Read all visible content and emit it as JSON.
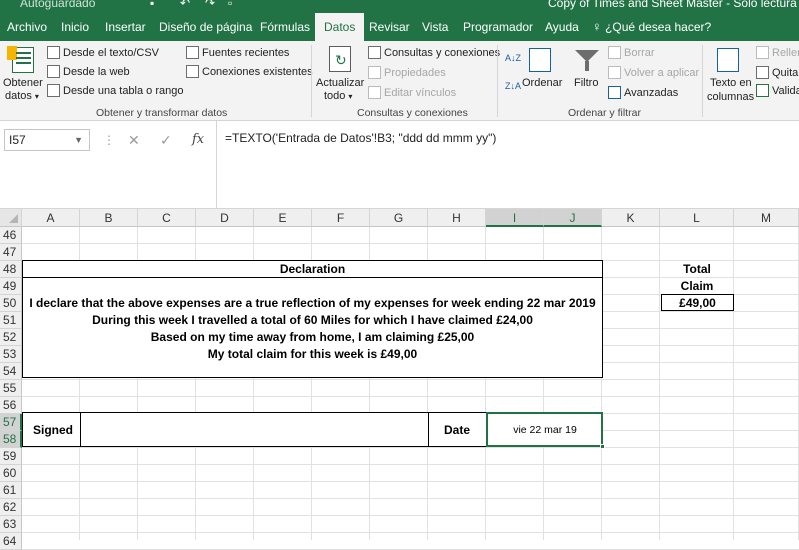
{
  "titlebar": {
    "autosave_label": "Autoguardado",
    "doc_title": "Copy of Times and Sheet Master - Solo lectura",
    "qa_save_icon": "save-icon",
    "qa_undo_icon": "undo-icon",
    "qa_redo_icon": "redo-icon",
    "qa_preview_icon": "print-preview-icon"
  },
  "tabs": [
    "Archivo",
    "Inicio",
    "Insertar",
    "Diseño de página",
    "Fórmulas",
    "Datos",
    "Revisar",
    "Vista",
    "Programador",
    "Ayuda"
  ],
  "active_tab": "Datos",
  "tell_me": "¿Qué desea hacer?",
  "ribbon": {
    "get_data": {
      "line1": "Obtener",
      "line2": "datos",
      "dropdown": "▾"
    },
    "from_text": "Desde el texto/CSV",
    "from_web": "Desde la web",
    "from_table": "Desde una tabla o rango",
    "recent_sources": "Fuentes recientes",
    "existing_connections": "Conexiones existentes",
    "group_get": "Obtener y transformar datos",
    "refresh": {
      "line1": "Actualizar",
      "line2": "todo",
      "dropdown": "▾"
    },
    "queries": "Consultas y conexiones",
    "properties": "Propiedades",
    "edit_links": "Editar vínculos",
    "group_queries": "Consultas y conexiones",
    "sort_az": "A↓Z",
    "sort_za": "Z↓A",
    "sort": "Ordenar",
    "filter": "Filtro",
    "clear": "Borrar",
    "reapply": "Volver a aplicar",
    "advanced": "Avanzadas",
    "group_sort": "Ordenar y filtrar",
    "text_to_columns": {
      "line1": "Texto en",
      "line2": "columnas"
    },
    "flash_fill": "Relleno",
    "remove_dupes": "Quitar",
    "validation": "Validac"
  },
  "formula_bar": {
    "name_box": "I57",
    "cancel": "✕",
    "enter": "✓",
    "fx": "fx",
    "formula": "=TEXTO('Entrada de Datos'!B3; \"ddd dd mmm yy\")"
  },
  "columns": [
    "A",
    "B",
    "C",
    "D",
    "E",
    "F",
    "G",
    "H",
    "I",
    "J",
    "K",
    "L",
    "M"
  ],
  "selected_columns": [
    "I",
    "J"
  ],
  "rows": [
    "46",
    "47",
    "48",
    "49",
    "50",
    "51",
    "52",
    "53",
    "54",
    "55",
    "56",
    "57",
    "58",
    "59",
    "60",
    "61",
    "62",
    "63",
    "64"
  ],
  "selected_rows": [
    "57",
    "58"
  ],
  "sheet": {
    "declaration_title": "Declaration",
    "line1": "I declare that the above expenses are a true reflection of my expenses for week ending  22 mar 2019",
    "line2": "During this week I travelled a total of 60 Miles for which I have claimed £24,00",
    "line3": "Based on my time away from home, I am claiming £25,00",
    "line4": "My total claim for this week is £49,00",
    "total_label_1": "Total",
    "total_label_2": "Claim",
    "total_value": "£49,00",
    "signed_label": "Signed",
    "date_label": "Date",
    "date_value": "vie 22 mar 19"
  }
}
